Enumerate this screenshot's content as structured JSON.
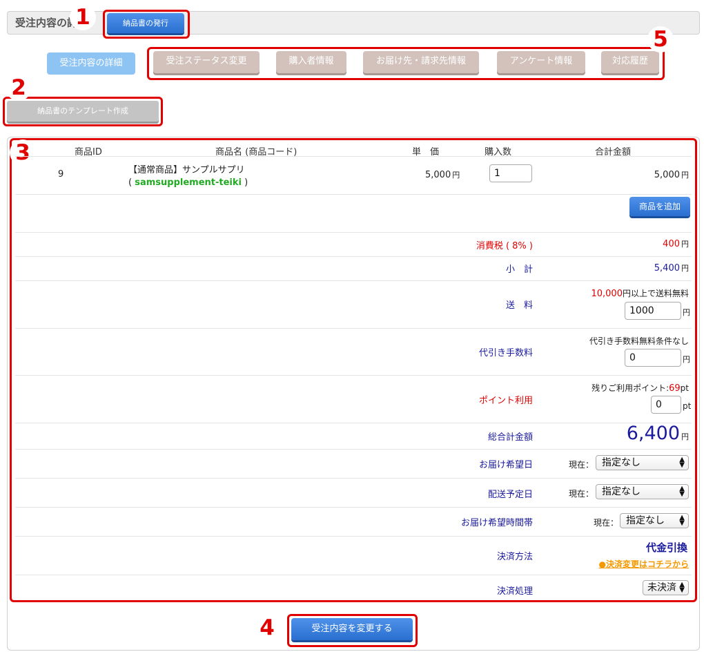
{
  "header": {
    "title": "受注内容の詳細"
  },
  "buttons": {
    "issue_invoice": "納品書の発行",
    "invoice_template": "納品書のテンプレート作成",
    "add_product": "商品を追加",
    "submit": "受注内容を変更する"
  },
  "tabs": {
    "active": "受注内容の詳細",
    "items": [
      "受注ステータス変更",
      "購入者情報",
      "お届け先・請求先情報",
      "アンケート情報",
      "対応履歴"
    ]
  },
  "markers": [
    "1",
    "2",
    "3",
    "4",
    "5"
  ],
  "table": {
    "headers": {
      "id": "商品ID",
      "name": "商品名 (商品コード)",
      "price": "単　価",
      "qty": "購入数",
      "total": "合計金額"
    },
    "row": {
      "id": "9",
      "name": "【通常商品】サンプルサプリ",
      "code_open": "( ",
      "code": "samsupplement-teiki",
      "code_close": " )",
      "price": "5,000",
      "qty": "1",
      "total": "5,000"
    }
  },
  "currency": "円",
  "summary": {
    "tax_label": "消費税 ( 8% )",
    "tax_value": "400",
    "subtotal_label": "小　計",
    "subtotal_value": "5,400",
    "shipping_label": "送　料",
    "shipping_threshold": "10,000",
    "shipping_note": "円以上で送料無料",
    "shipping_value": "1000",
    "cod_label": "代引き手数料",
    "cod_note": "代引き手数料無料条件なし",
    "cod_value": "0",
    "point_label": "ポイント利用",
    "point_note": "残りご利用ポイント:",
    "point_remaining": "69",
    "point_unit": "pt",
    "point_value": "0",
    "grand_label": "総合計金額",
    "grand_value": "6,400"
  },
  "delivery": {
    "date_label": "お届け希望日",
    "ship_label": "配送予定日",
    "time_label": "お届け希望時間帯",
    "current": "現在：",
    "none": "指定なし"
  },
  "payment": {
    "method_label": "決済方法",
    "method_value": "代金引換",
    "change_link": "●決済変更はコチラから",
    "process_label": "決済処理",
    "process_value": "未決済"
  },
  "colors": {
    "accent_blue": "#2a6fd0",
    "marker_red": "#e00000",
    "label_blue": "#1a1a9c",
    "code_green": "#22aa22",
    "link_orange": "#f39800"
  }
}
